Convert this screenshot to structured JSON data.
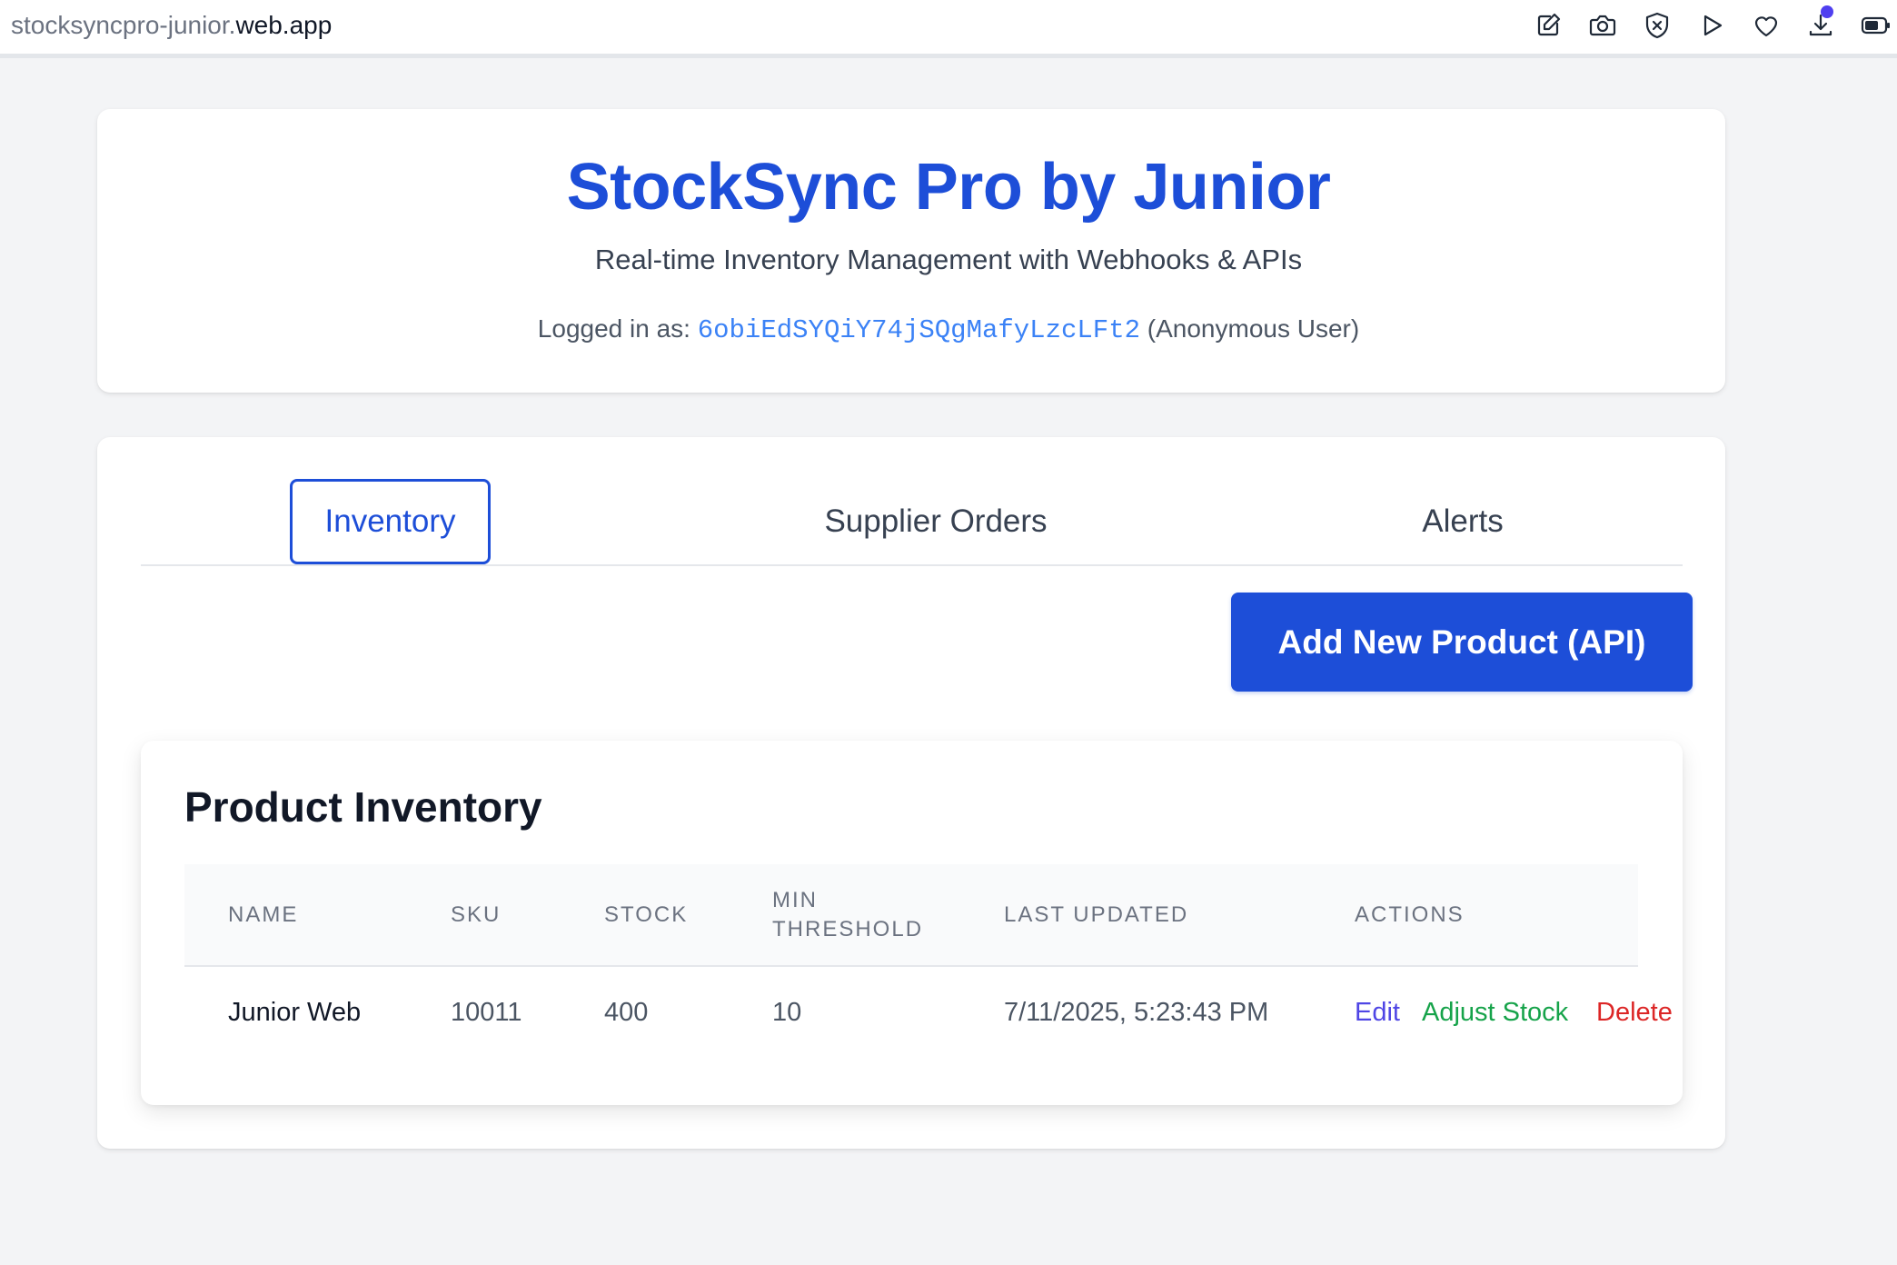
{
  "browser": {
    "url_prefix": "stocksyncpro-junior.",
    "url_domain": "web.app",
    "icons": [
      "edit-page-icon",
      "camera-icon",
      "shield-icon",
      "play-icon",
      "heart-icon",
      "download-icon",
      "battery-icon"
    ]
  },
  "header": {
    "title": "StockSync Pro by Junior",
    "subtitle": "Real-time Inventory Management with Webhooks & APIs",
    "logged_in_label": "Logged in as:",
    "user_id": "6obiEdSYQiY74jSQgMafyLzcLFt2",
    "user_type": "(Anonymous User)"
  },
  "tabs": [
    {
      "label": "Inventory",
      "active": true
    },
    {
      "label": "Supplier Orders",
      "active": false
    },
    {
      "label": "Alerts",
      "active": false
    }
  ],
  "add_button": "Add New Product (API)",
  "inventory": {
    "title": "Product Inventory",
    "columns": [
      "Name",
      "SKU",
      "Stock",
      "Min Threshold",
      "Last Updated",
      "Actions"
    ],
    "rows": [
      {
        "name": "Junior Web",
        "sku": "10011",
        "stock": "400",
        "min_threshold": "10",
        "last_updated": "7/11/2025, 5:23:43 PM",
        "actions": {
          "edit": "Edit",
          "adjust": "Adjust Stock",
          "delete": "Delete"
        }
      }
    ]
  },
  "colors": {
    "accent": "#1d4ed8",
    "edit": "#4f46e5",
    "adjust": "#16a34a",
    "delete": "#dc2626",
    "notification_dot": "#4f3ff0"
  }
}
